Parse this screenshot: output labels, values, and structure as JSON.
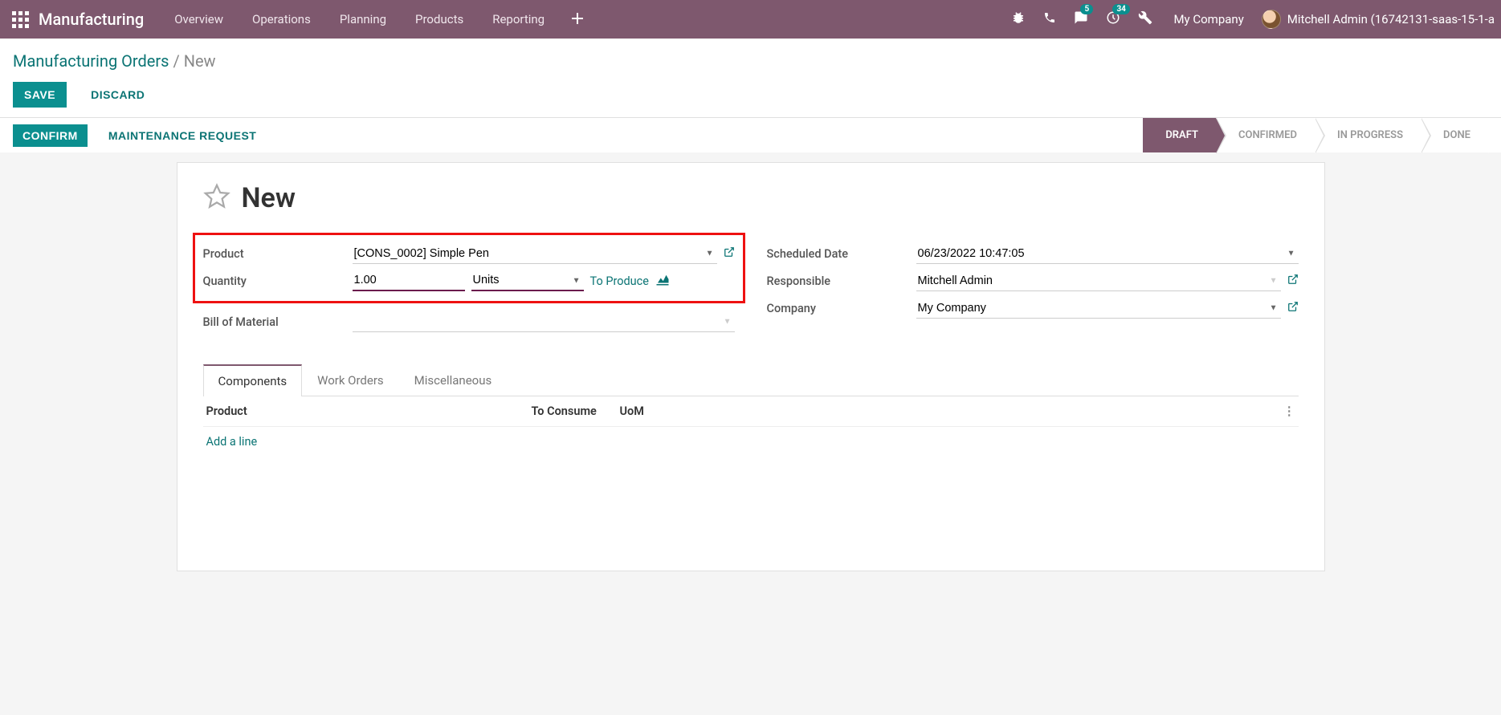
{
  "navbar": {
    "brand": "Manufacturing",
    "menu": [
      "Overview",
      "Operations",
      "Planning",
      "Products",
      "Reporting"
    ],
    "badges": {
      "messages": "5",
      "activities": "34"
    },
    "company": "My Company",
    "user": "Mitchell Admin (16742131-saas-15-1-a"
  },
  "breadcrumb": {
    "parent": "Manufacturing Orders",
    "separator": " / ",
    "current": "New"
  },
  "actions": {
    "save": "SAVE",
    "discard": "DISCARD"
  },
  "statusbar": {
    "confirm": "CONFIRM",
    "maintenance": "MAINTENANCE REQUEST",
    "steps": [
      "DRAFT",
      "CONFIRMED",
      "IN PROGRESS",
      "DONE"
    ],
    "active_step": 0
  },
  "title": "New",
  "form": {
    "left": {
      "product_label": "Product",
      "product_value": "[CONS_0002] Simple Pen",
      "quantity_label": "Quantity",
      "quantity_value": "1.00",
      "quantity_uom": "Units",
      "to_produce": "To Produce",
      "bom_label": "Bill of Material",
      "bom_value": ""
    },
    "right": {
      "scheduled_label": "Scheduled Date",
      "scheduled_value": "06/23/2022 10:47:05",
      "responsible_label": "Responsible",
      "responsible_value": "Mitchell Admin",
      "company_label": "Company",
      "company_value": "My Company"
    }
  },
  "tabs": {
    "items": [
      "Components",
      "Work Orders",
      "Miscellaneous"
    ],
    "active": 0,
    "columns": {
      "product": "Product",
      "consume": "To Consume",
      "uom": "UoM"
    },
    "add_line": "Add a line"
  }
}
